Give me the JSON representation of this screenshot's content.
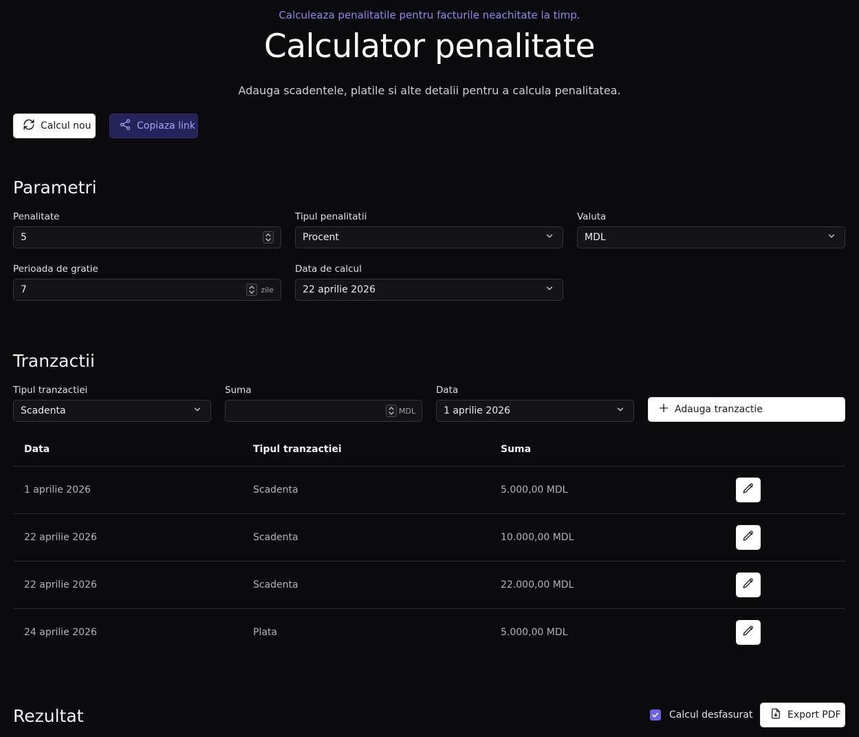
{
  "header": {
    "tagline": "Calculeaza penalitatile pentru facturile neachitate la timp.",
    "title": "Calculator penalitate",
    "description": "Adauga scadentele, platile si alte detalii pentru a calcula penalitatea."
  },
  "actions": {
    "new_calc_label": "Calcul nou",
    "copy_link_label": "Copiaza link"
  },
  "parameters": {
    "section_title": "Parametri",
    "penalty_label": "Penalitate",
    "penalty_value": "5",
    "penalty_type_label": "Tipul penalitatii",
    "penalty_type_value": "Procent",
    "currency_label": "Valuta",
    "currency_value": "MDL",
    "grace_label": "Perioada de gratie",
    "grace_value": "7",
    "grace_suffix": "zile",
    "calc_date_label": "Data de calcul",
    "calc_date_value": "22 aprilie 2026"
  },
  "transactions": {
    "section_title": "Tranzactii",
    "type_label": "Tipul tranzactiei",
    "type_value": "Scadenta",
    "amount_label": "Suma",
    "amount_value": "",
    "amount_suffix": "MDL",
    "date_label": "Data",
    "date_value": "1 aprilie 2026",
    "add_button_label": "Adauga tranzactie",
    "table": {
      "headers": [
        "Data",
        "Tipul tranzactiei",
        "Suma"
      ],
      "rows": [
        {
          "date": "1 aprilie 2026",
          "type": "Scadenta",
          "amount": "5.000,00 MDL"
        },
        {
          "date": "22 aprilie 2026",
          "type": "Scadenta",
          "amount": "10.000,00 MDL"
        },
        {
          "date": "22 aprilie 2026",
          "type": "Scadenta",
          "amount": "22.000,00 MDL"
        },
        {
          "date": "24 aprilie 2026",
          "type": "Plata",
          "amount": "5.000,00 MDL"
        }
      ]
    }
  },
  "result": {
    "section_title": "Rezultat",
    "detailed_label": "Calcul desfasurat",
    "detailed_checked": true,
    "export_label": "Export PDF"
  },
  "colors": {
    "background": "#0b0b0d",
    "accent": "#8f88f2",
    "checkbox": "#6d63e6"
  },
  "icons": [
    "refresh-icon",
    "share-icon",
    "chevron-down-icon",
    "stepper-icon",
    "plus-icon",
    "pencil-icon",
    "check-icon",
    "file-download-icon"
  ]
}
